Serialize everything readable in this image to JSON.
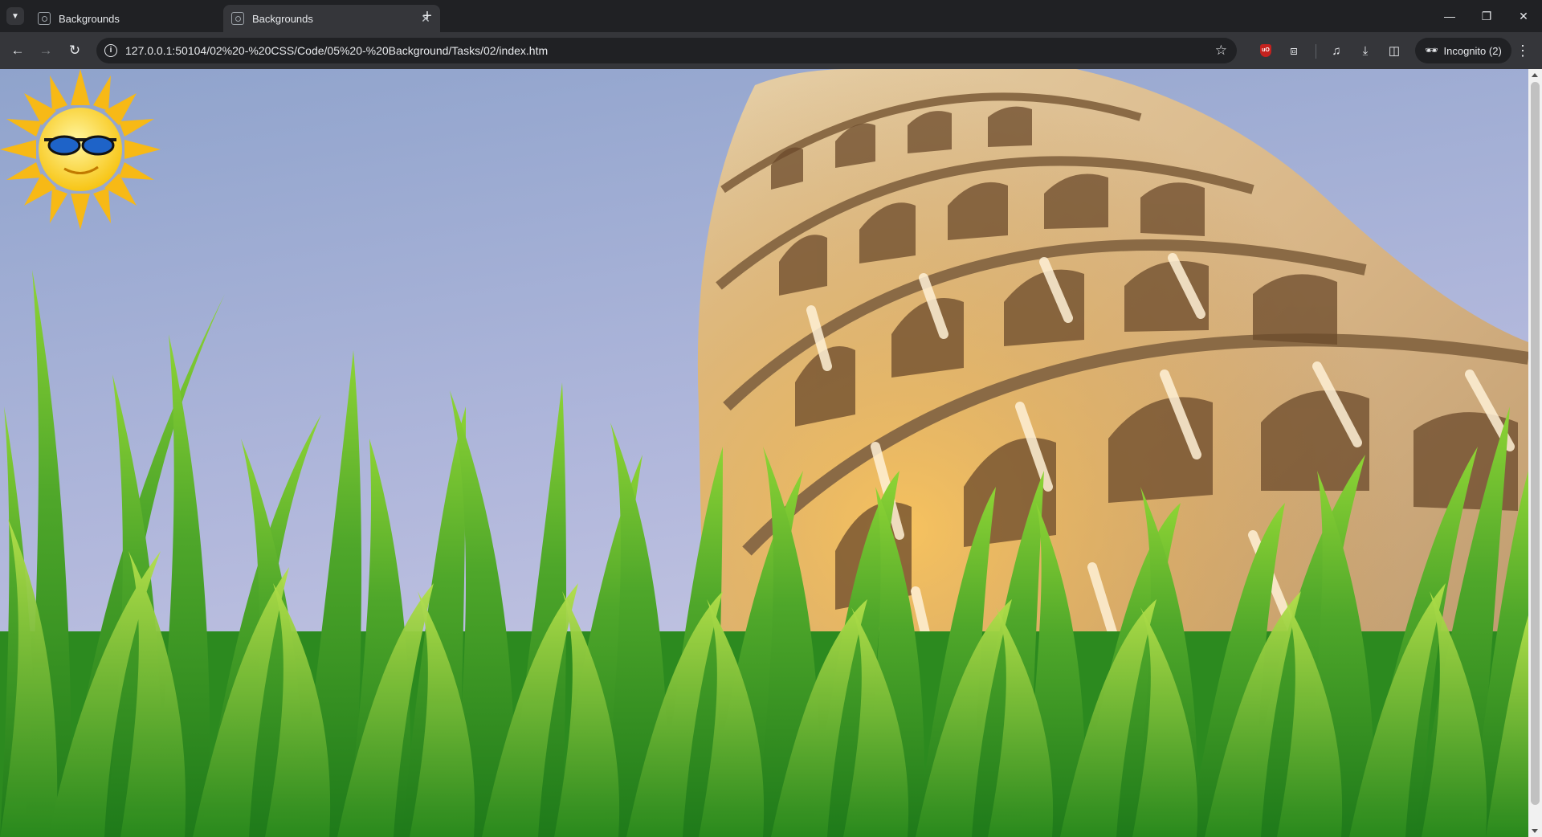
{
  "tabs": [
    {
      "title": "Backgrounds",
      "active": false
    },
    {
      "title": "Backgrounds",
      "active": true
    }
  ],
  "address_bar": {
    "url": "127.0.0.1:50104/02%20-%20CSS/Code/05%20-%20Background/Tasks/02/index.htm"
  },
  "profile": {
    "label": "Incognito (2)"
  },
  "icons": {
    "tab_search": "chevron-down-icon",
    "favicon": "radio-broadcast-icon",
    "back": "arrow-left-icon",
    "forward": "arrow-right-icon",
    "reload": "reload-icon",
    "site_info": "info-icon",
    "bookmark": "star-icon",
    "ublock": "ublock-origin-icon",
    "extensions": "puzzle-icon",
    "media": "media-queue-icon",
    "downloads": "download-icon",
    "side_panel": "side-panel-icon",
    "incognito": "incognito-icon",
    "menu": "kebab-menu-icon"
  },
  "page": {
    "sky_top_color": "#8fa3cc",
    "sky_bottom_color": "#c9c9e4",
    "grass_color": "#5fb32a",
    "tower_color": "#d9b98c"
  }
}
